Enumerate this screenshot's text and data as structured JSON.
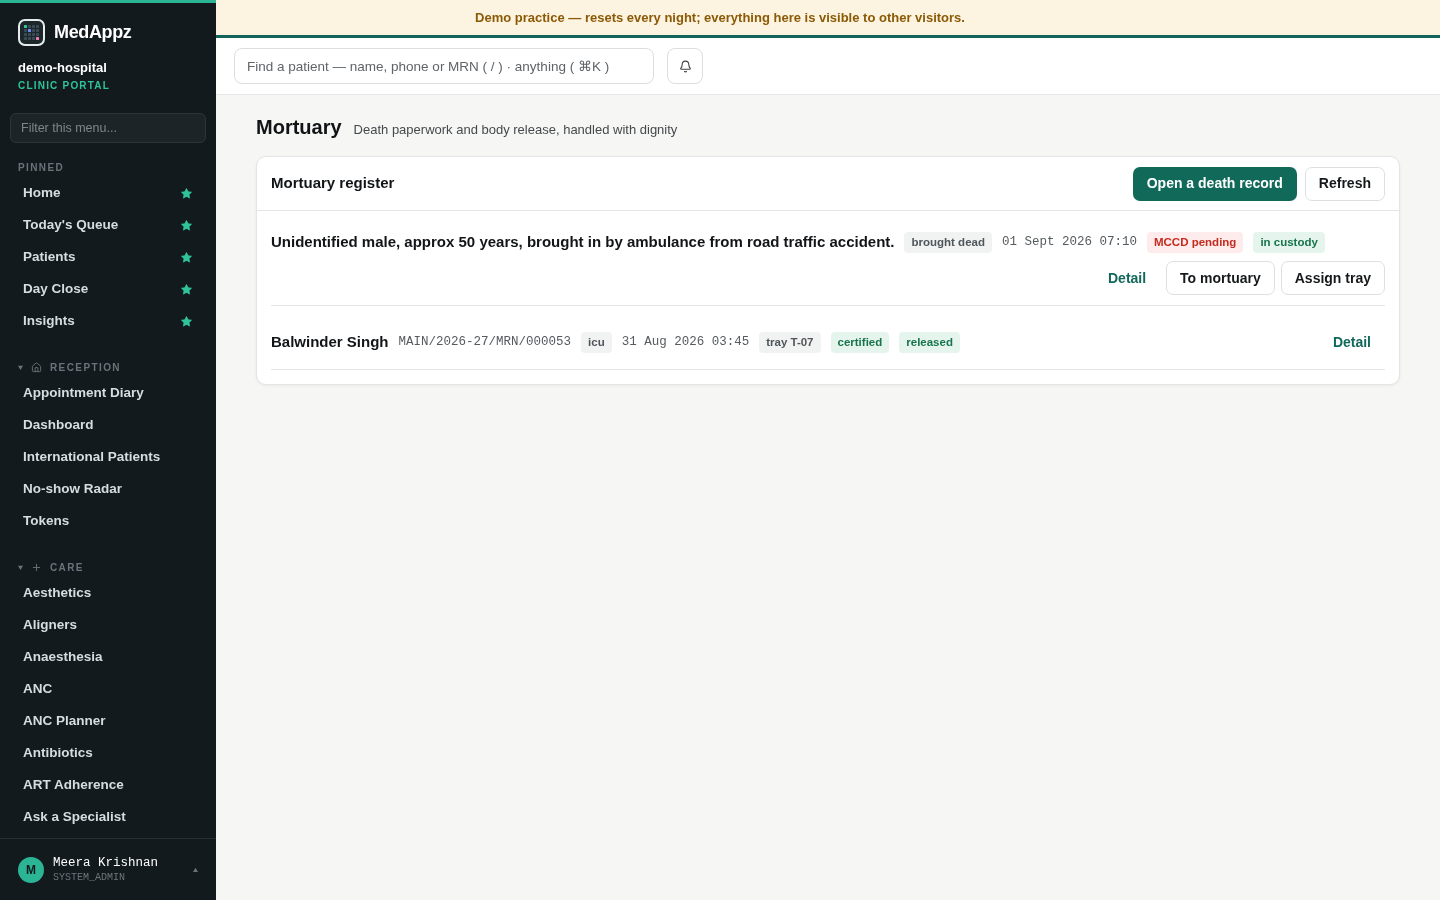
{
  "banner": {
    "text": "Demo practice — resets every night; everything here is visible to other visitors."
  },
  "sidebar": {
    "brand": "MedAppz",
    "organization": "demo-hospital",
    "portal": "CLINIC PORTAL",
    "filter": {
      "placeholder": "Filter this menu..."
    },
    "sections": [
      {
        "title": "PINNED",
        "kind": "pinned",
        "items": [
          {
            "label": "Home",
            "pinned": true
          },
          {
            "label": "Today's Queue",
            "pinned": true
          },
          {
            "label": "Patients",
            "pinned": true
          },
          {
            "label": "Day Close",
            "pinned": true
          },
          {
            "label": "Insights",
            "pinned": true
          }
        ]
      },
      {
        "title": "RECEPTION",
        "kind": "reception",
        "expanded": true,
        "items": [
          {
            "label": "Appointment Diary",
            "pinned": false
          },
          {
            "label": "Dashboard",
            "pinned": false
          },
          {
            "label": "International Patients",
            "pinned": false
          },
          {
            "label": "No-show Radar",
            "pinned": false
          },
          {
            "label": "Tokens",
            "pinned": false
          }
        ]
      },
      {
        "title": "CARE",
        "kind": "care",
        "expanded": true,
        "items": [
          {
            "label": "Aesthetics",
            "pinned": false
          },
          {
            "label": "Aligners",
            "pinned": false
          },
          {
            "label": "Anaesthesia",
            "pinned": false
          },
          {
            "label": "ANC",
            "pinned": false
          },
          {
            "label": "ANC Planner",
            "pinned": false
          },
          {
            "label": "Antibiotics",
            "pinned": false
          },
          {
            "label": "ART Adherence",
            "pinned": false
          },
          {
            "label": "Ask a Specialist",
            "pinned": false
          }
        ]
      }
    ],
    "user": {
      "initial": "M",
      "name": "Meera Krishnan",
      "role": "SYSTEM_ADMIN"
    }
  },
  "header": {
    "search": {
      "placeholder": "Find a patient — name, phone or MRN ( / ) · anything ( ⌘K )"
    }
  },
  "page": {
    "title": "Mortuary",
    "subtitle": "Death paperwork and body release, handled with dignity"
  },
  "register": {
    "title": "Mortuary register",
    "actions": [
      {
        "label": "Open a death record",
        "kind": "primary"
      },
      {
        "label": "Refresh",
        "kind": "secondary"
      }
    ],
    "records": [
      {
        "name": "Unidentified male, approx 50 years, brought in by ambulance from road traffic accident.",
        "meta": [
          {
            "text": "brought dead",
            "kind": "tag"
          },
          {
            "text": "01 Sept 2026 07:10",
            "kind": "time"
          },
          {
            "text": "MCCD pending",
            "kind": "danger"
          },
          {
            "text": "in custody",
            "kind": "success"
          }
        ],
        "actions": [
          {
            "label": "Detail",
            "kind": "link"
          },
          {
            "label": "To mortuary",
            "kind": "secondary"
          },
          {
            "label": "Assign tray",
            "kind": "secondary"
          }
        ]
      },
      {
        "name": "Balwinder Singh",
        "meta": [
          {
            "text": "MAIN/2026-27/MRN/000053",
            "kind": "id"
          },
          {
            "text": "icu",
            "kind": "tag"
          },
          {
            "text": "31 Aug 2026 03:45",
            "kind": "time"
          },
          {
            "text": "tray T-07",
            "kind": "tag"
          },
          {
            "text": "certified",
            "kind": "success"
          },
          {
            "text": "released",
            "kind": "success"
          }
        ],
        "actions": [
          {
            "label": "Detail",
            "kind": "link"
          }
        ]
      }
    ]
  }
}
